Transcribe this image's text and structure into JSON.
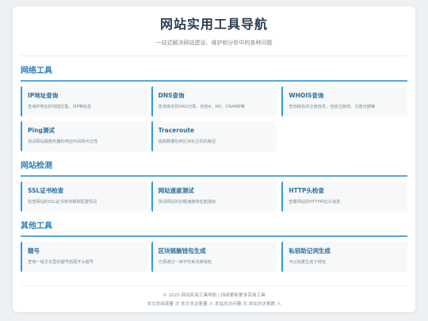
{
  "header": {
    "title": "网站实用工具导航",
    "subtitle": "一站式解决网站建设、维护和分析中的各种问题"
  },
  "sections": [
    {
      "title": "网络工具",
      "tools": [
        {
          "name": "IP地址查询",
          "desc": "查询IP地址的地理位置、ISP等信息"
        },
        {
          "name": "DNS查询",
          "desc": "查询域名的DNS记录，包括A、MX、CNAME等"
        },
        {
          "name": "WHOIS查询",
          "desc": "查询域名的注册信息，包括注册商、注册日期等"
        },
        {
          "name": "Ping测试",
          "desc": "测试网站或服务器的响应时间和可达性"
        },
        {
          "name": "Traceroute",
          "desc": "追踪数据包到达目标主机的路径"
        }
      ]
    },
    {
      "title": "网站检测",
      "tools": [
        {
          "name": "SSL证书检查",
          "desc": "检查网站的SSL证书有效期和配置情况"
        },
        {
          "name": "网站速度测试",
          "desc": "测试网站的加载速度和性能指标"
        },
        {
          "name": "HTTP头检查",
          "desc": "查看网站的HTTP响应头信息"
        }
      ]
    },
    {
      "title": "其他工具",
      "tools": [
        {
          "name": "靓号",
          "desc": "查询一组文本里的靓号结尾开头靓号"
        },
        {
          "name": "区块链脑钱包生成",
          "desc": "方便通过一串字符来兑换钱包"
        },
        {
          "name": "私钥助记词生成",
          "desc": "可以批量生成子钱包"
        }
      ]
    }
  ],
  "footer": {
    "copyright": "© 2025 网站实用工具导航 | 持续更新更多实用工具",
    "stats": "本文总阅读量 次 本文总访客量 人 本站总访问量 次 本站总访客数 人"
  },
  "colors": {
    "accent": "#3498db",
    "card_title": "#2a6f9e",
    "section_title": "#2a80b9"
  }
}
